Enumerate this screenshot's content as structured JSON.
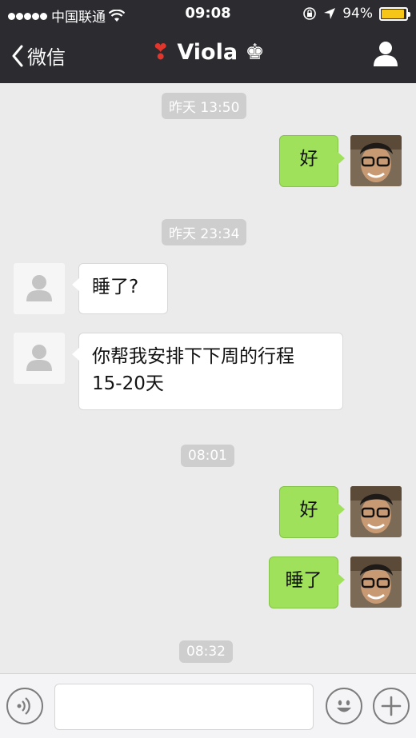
{
  "status_bar": {
    "carrier": "中国联通",
    "time": "09:08",
    "battery_percent": "94%",
    "battery_level": 0.94,
    "battery_color": "#f5c518"
  },
  "nav": {
    "back_label": "微信",
    "title_prefix": "❣",
    "title": "Viola",
    "title_suffix": "♚",
    "profile_icon": "person-icon"
  },
  "messages": [
    {
      "type": "timestamp",
      "text": "昨天 13:50"
    },
    {
      "type": "message",
      "sender": "me",
      "text": "好"
    },
    {
      "type": "timestamp",
      "text": "昨天 23:34"
    },
    {
      "type": "message",
      "sender": "them",
      "text": "睡了?"
    },
    {
      "type": "message",
      "sender": "them",
      "text": "你帮我安排下下周的行程\n15-20天"
    },
    {
      "type": "timestamp",
      "text": "08:01"
    },
    {
      "type": "message",
      "sender": "me",
      "text": "好"
    },
    {
      "type": "message",
      "sender": "me",
      "text": "睡了"
    },
    {
      "type": "timestamp",
      "text": "08:32"
    }
  ],
  "input_bar": {
    "voice_icon": "voice-icon",
    "text_value": "",
    "emoji_icon": "emoji-icon",
    "plus_icon": "plus-icon"
  },
  "colors": {
    "nav_bg": "#2b2b30",
    "chat_bg": "#ebebeb",
    "my_bubble": "#9fe15a",
    "their_bubble": "#ffffff"
  }
}
